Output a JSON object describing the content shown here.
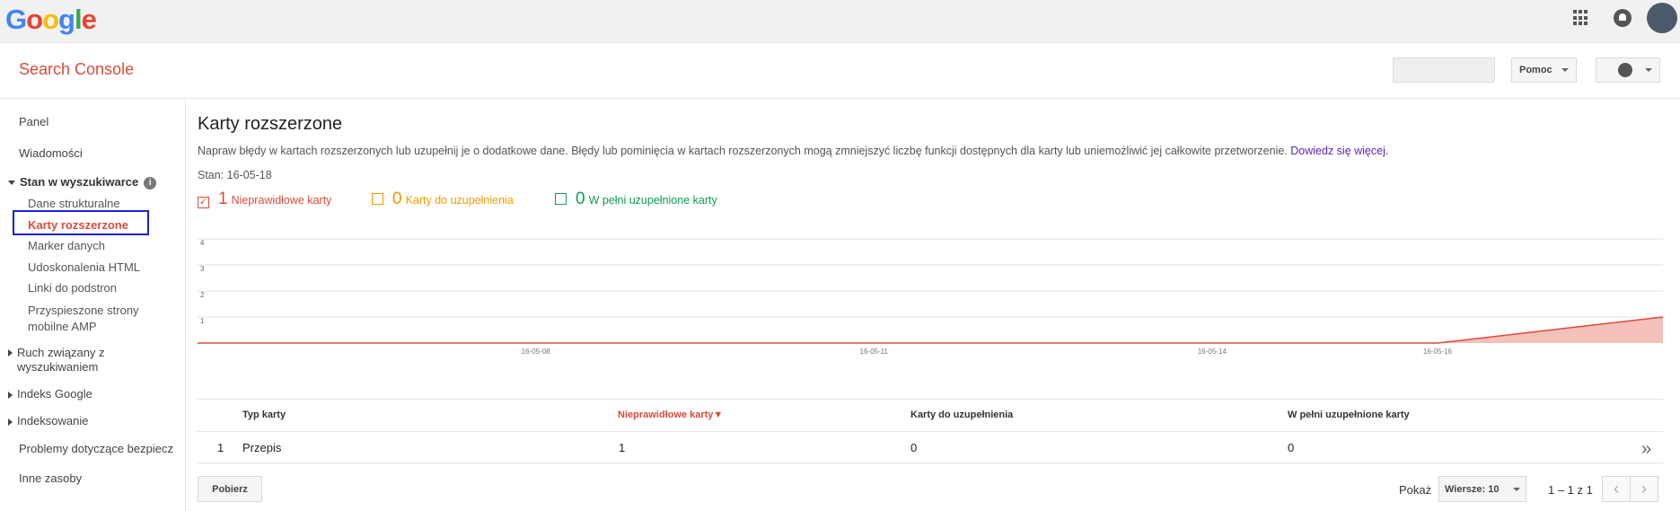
{
  "google": {
    "logo_letters": [
      "G",
      "o",
      "o",
      "g",
      "l",
      "e"
    ],
    "logo_colors": [
      "#4285f4",
      "#ea4335",
      "#fbbc05",
      "#4285f4",
      "#34a853",
      "#ea4335"
    ]
  },
  "header": {
    "title": "Search Console",
    "help_label": "Pomoc"
  },
  "sidebar": {
    "panel": "Panel",
    "messages": "Wiadomości",
    "search_status": "Stan w wyszukiwarce",
    "sub": [
      "Dane strukturalne",
      "Karty rozszerzone",
      "Marker danych",
      "Udoskonalenia HTML",
      "Linki do podstron",
      "Przyspieszone strony mobilne AMP"
    ],
    "traffic": "Ruch związany z wyszukiwaniem",
    "index": "Indeks Google",
    "crawl": "Indeksowanie",
    "security": "Problemy dotyczące bezpiecz",
    "other": "Inne zasoby"
  },
  "main": {
    "title": "Karty rozszerzone",
    "description": "Napraw błędy w kartach rozszerzonych lub uzupełnij je o dodatkowe dane. Błędy lub pominięcia w kartach rozszerzonych mogą zmniejszyć liczbę funkcji dostępnych dla karty lub uniemożliwić jej całkowite przetworzenie.",
    "learn_more": "Dowiedz się więcej.",
    "status": "Stan: 16-05-18",
    "legend": [
      {
        "count": "1",
        "label": "Nieprawidłowe karty",
        "color": "#dd4b39",
        "checked": true
      },
      {
        "count": "0",
        "label": "Karty do uzupełnienia",
        "color": "#f29900",
        "checked": false
      },
      {
        "count": "0",
        "label": "W pełni uzupełnione karty",
        "color": "#0f9d58",
        "checked": false
      }
    ]
  },
  "chart_data": {
    "type": "area",
    "x_ticks": [
      "16-05-08",
      "16-05-11",
      "16-05-14",
      "16-05-16"
    ],
    "y_ticks": [
      "4",
      "3",
      "2",
      "1"
    ],
    "ylim": [
      0,
      4
    ],
    "series": [
      {
        "name": "Nieprawidłowe karty",
        "color": "#dd4b39",
        "x": [
          "16-05-05",
          "16-05-16",
          "16-05-18"
        ],
        "values": [
          0,
          0,
          1
        ]
      }
    ]
  },
  "table": {
    "headers": [
      "Typ karty",
      "Nieprawidłowe karty▼",
      "Karty do uzupełnienia",
      "W pełni uzupełnione karty"
    ],
    "rows": [
      {
        "index": "1",
        "type": "Przepis",
        "invalid": "1",
        "incomplete": "0",
        "complete": "0"
      }
    ]
  },
  "footer": {
    "download": "Pobierz",
    "show": "Pokaż",
    "rows_select": "Wiersze: 10",
    "range": "1 – 1 z 1"
  }
}
